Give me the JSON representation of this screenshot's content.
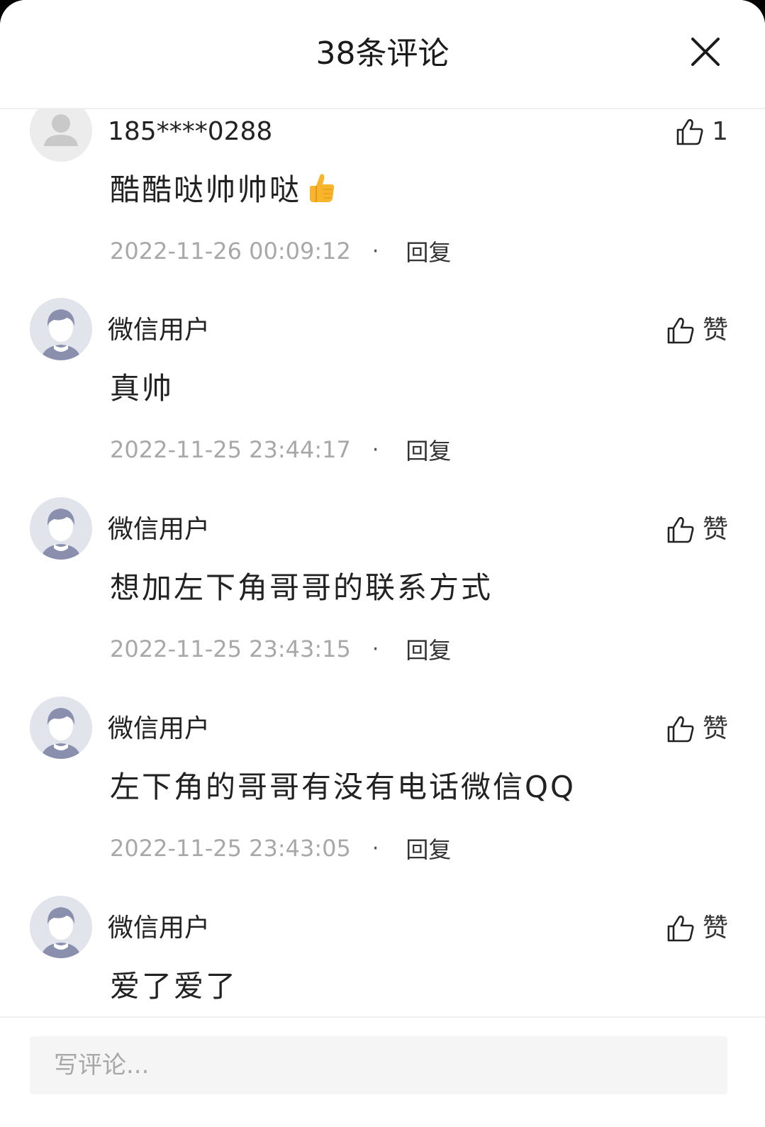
{
  "header": {
    "title": "38条评论"
  },
  "comments": [
    {
      "username": "185****0288",
      "like": "1",
      "content": "酷酷哒帅帅哒",
      "emoji": "thumbs-up-emoji",
      "time": "2022-11-26 00:09:12",
      "dot": "·",
      "reply": "回复"
    },
    {
      "username": "微信用户",
      "like": "赞",
      "content": "真帅",
      "time": "2022-11-25 23:44:17",
      "dot": "·",
      "reply": "回复"
    },
    {
      "username": "微信用户",
      "like": "赞",
      "content": "想加左下角哥哥的联系方式",
      "time": "2022-11-25 23:43:15",
      "dot": "·",
      "reply": "回复"
    },
    {
      "username": "微信用户",
      "like": "赞",
      "content": "左下角的哥哥有没有电话微信QQ",
      "time": "2022-11-25 23:43:05",
      "dot": "·",
      "reply": "回复"
    },
    {
      "username": "微信用户",
      "like": "赞",
      "content": "爱了爱了"
    }
  ],
  "footer": {
    "placeholder": "写评论..."
  },
  "icons": {
    "close": "close-icon",
    "like": "thumbs-up-icon",
    "avatar_default": "default-avatar-icon",
    "avatar_wechat": "wechat-user-avatar-icon"
  },
  "colors": {
    "text": "#222222",
    "muted": "#a8a8a8",
    "divider": "#efefef",
    "input_bg": "#f5f5f5"
  }
}
